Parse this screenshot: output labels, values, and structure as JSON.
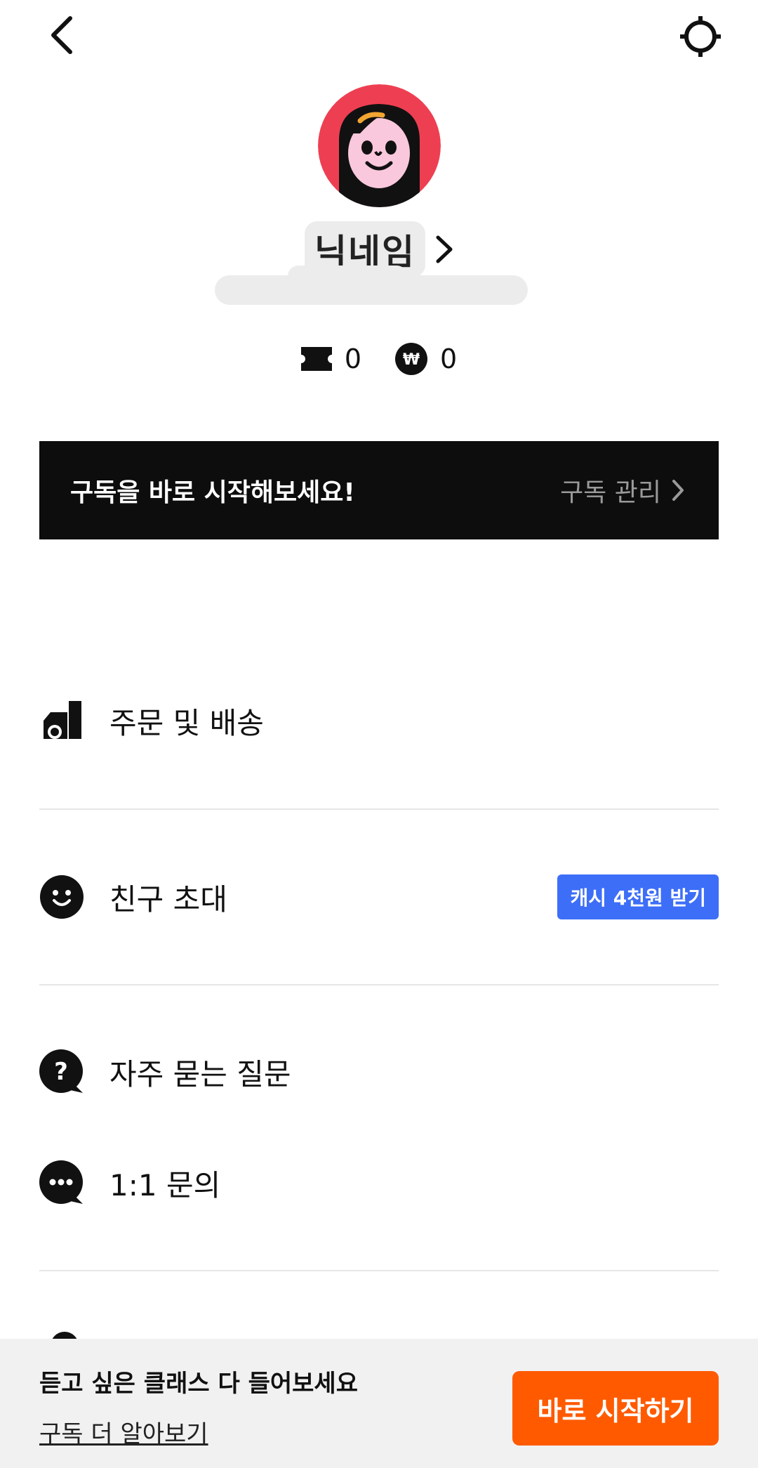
{
  "profile": {
    "nickname": "닉네임"
  },
  "counters": {
    "coupon_count": "0",
    "cash_count": "0"
  },
  "subscribe_banner": {
    "text": "구독을 바로 시작해보세요!",
    "manage_label": "구독 관리"
  },
  "menu": {
    "orders_label": "주문 및 배송",
    "invite_label": "친구 초대",
    "invite_badge": "캐시 4천원 받기",
    "faq_label": "자주 묻는 질문",
    "inquiry_label": "1:1 문의"
  },
  "bottom_cta": {
    "title": "듣고 싶은 클래스 다 들어보세요",
    "link": "구독 더 알아보기",
    "button": "바로 시작하기"
  },
  "colors": {
    "accent_orange": "#ff5a00",
    "badge_blue": "#3d6ef7",
    "avatar_red": "#ee3f52",
    "banner_black": "#0d0d0d"
  }
}
